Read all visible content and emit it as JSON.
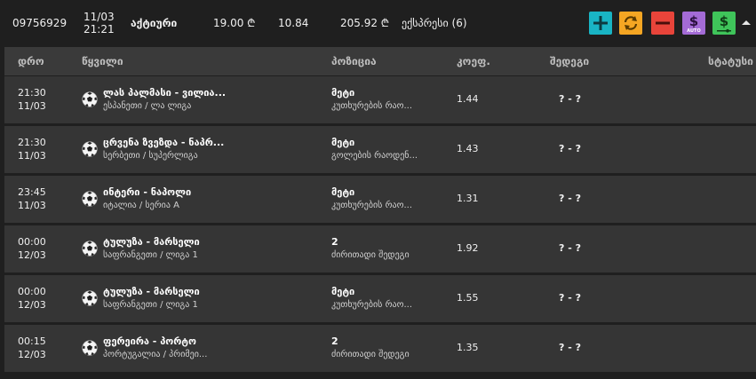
{
  "bet": {
    "id": "09756929",
    "date": "11/03",
    "time": "21:21",
    "status": "აქტიური",
    "stake": "19.00 ₾",
    "odds": "10.84",
    "win": "205.92 ₾",
    "type": "ექსპრესი (6)"
  },
  "actions": {
    "auto_label": "AUTO",
    "colors": {
      "add": "#19b4c4",
      "cashout": "#f5a623",
      "remove": "#e8443a",
      "auto": "#a46bd6",
      "cash": "#3fc45a"
    }
  },
  "columns": {
    "time": "დრო",
    "event": "წყვილი",
    "position": "პოზიცია",
    "coef": "კოეფ.",
    "result": "შედეგი",
    "status": "სტატუსი"
  },
  "rows": [
    {
      "time": "21:30",
      "date": "11/03",
      "event": "ლას პალმასი - ვილია...",
      "league": "ესპანეთი / ლა ლიგა",
      "position": "მეტი",
      "market": "კუთხურების რაო...",
      "coef": "1.44",
      "result": "? - ?",
      "icon": "soccer-ball-icon"
    },
    {
      "time": "21:30",
      "date": "11/03",
      "event": "ცრვენა ზვეზდა - ნაპრ...",
      "league": "სერბეთი / სუპერლიგა",
      "position": "მეტი",
      "market": "გოლების რაოდენ...",
      "coef": "1.43",
      "result": "? - ?",
      "icon": "soccer-ball-icon"
    },
    {
      "time": "23:45",
      "date": "11/03",
      "event": "ინტერი - ნაპოლი",
      "league": "იტალია / სერია A",
      "position": "მეტი",
      "market": "კუთხურების რაო...",
      "coef": "1.31",
      "result": "? - ?",
      "icon": "soccer-ball-icon"
    },
    {
      "time": "00:00",
      "date": "12/03",
      "event": "ტულუზა - მარსელი",
      "league": "საფრანგეთი / ლიგა 1",
      "position": "2",
      "market": "ძირითადი შედეგი",
      "coef": "1.92",
      "result": "? - ?",
      "icon": "soccer-ball-icon"
    },
    {
      "time": "00:00",
      "date": "12/03",
      "event": "ტულუზა - მარსელი",
      "league": "საფრანგეთი / ლიგა 1",
      "position": "მეტი",
      "market": "კუთხურების რაო...",
      "coef": "1.55",
      "result": "? - ?",
      "icon": "soccer-ball-icon"
    },
    {
      "time": "00:15",
      "date": "12/03",
      "event": "ფერეირა - პორტო",
      "league": "პორტუგალია / პრიმეი...",
      "position": "2",
      "market": "ძირითადი შედეგი",
      "coef": "1.35",
      "result": "? - ?",
      "icon": "soccer-ball-icon"
    }
  ]
}
